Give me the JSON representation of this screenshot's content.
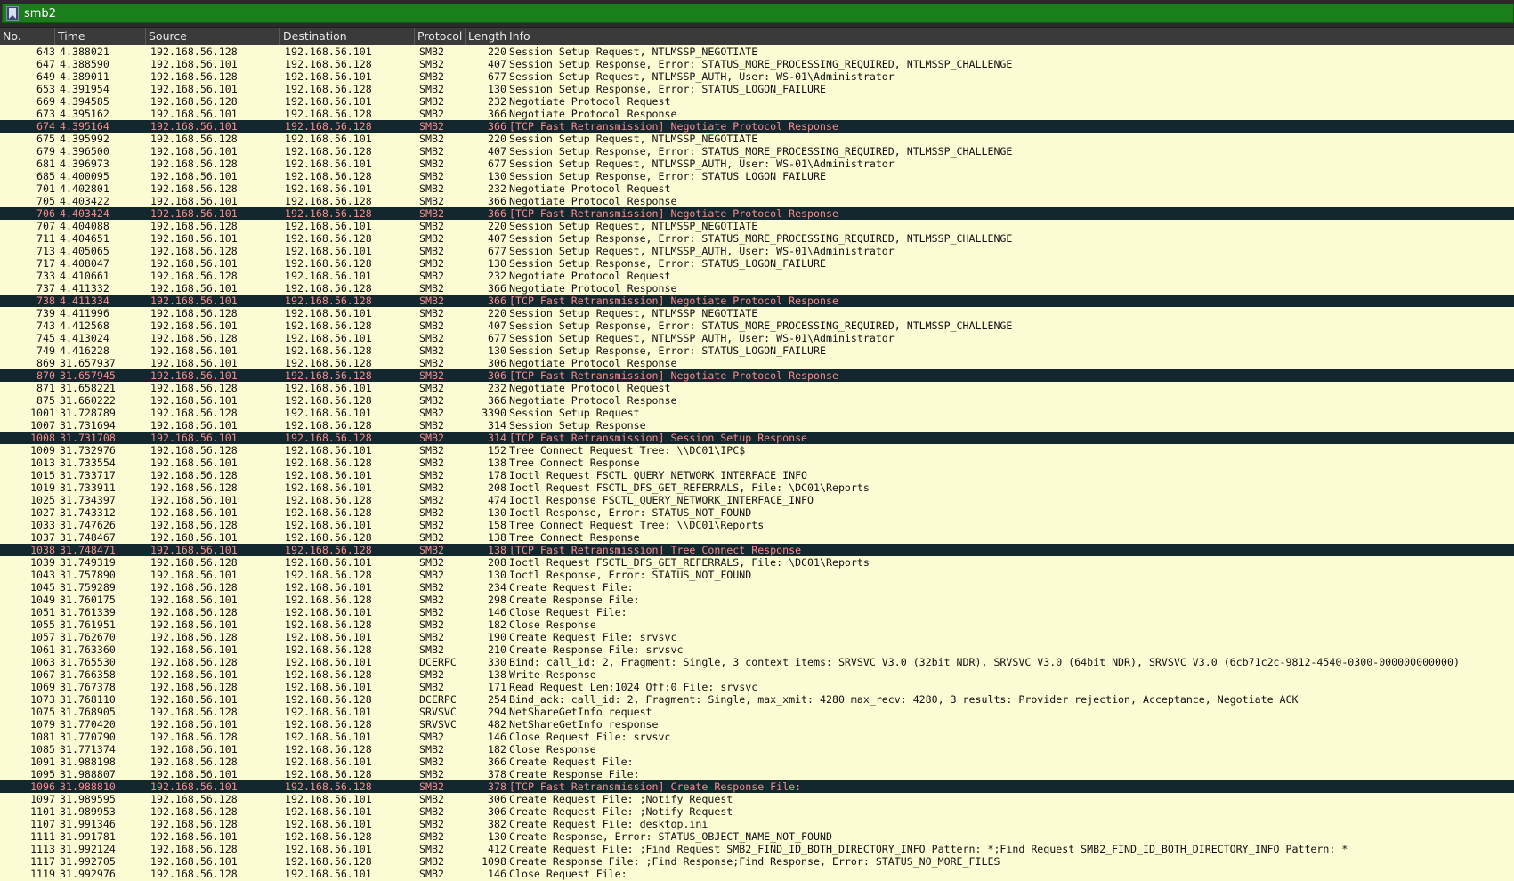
{
  "filter": {
    "value": "smb2"
  },
  "columns": [
    "No.",
    "Time",
    "Source",
    "Destination",
    "Protocol",
    "Length",
    "Info"
  ],
  "colors": {
    "row_bg": "#fbfbd4",
    "retrans_bg": "#12272e",
    "retrans_fg": "#f78c8c",
    "filter_bg": "#1a7f1a"
  },
  "rows": [
    {
      "no": "643",
      "time": "4.388021",
      "src": "192.168.56.128",
      "dst": "192.168.56.101",
      "proto": "SMB2",
      "len": "220",
      "info": "Session Setup Request, NTLMSSP_NEGOTIATE"
    },
    {
      "no": "647",
      "time": "4.388590",
      "src": "192.168.56.101",
      "dst": "192.168.56.128",
      "proto": "SMB2",
      "len": "407",
      "info": "Session Setup Response, Error: STATUS_MORE_PROCESSING_REQUIRED, NTLMSSP_CHALLENGE"
    },
    {
      "no": "649",
      "time": "4.389011",
      "src": "192.168.56.128",
      "dst": "192.168.56.101",
      "proto": "SMB2",
      "len": "677",
      "info": "Session Setup Request, NTLMSSP_AUTH, User: WS-01\\Administrator"
    },
    {
      "no": "653",
      "time": "4.391954",
      "src": "192.168.56.101",
      "dst": "192.168.56.128",
      "proto": "SMB2",
      "len": "130",
      "info": "Session Setup Response, Error: STATUS_LOGON_FAILURE"
    },
    {
      "no": "669",
      "time": "4.394585",
      "src": "192.168.56.128",
      "dst": "192.168.56.101",
      "proto": "SMB2",
      "len": "232",
      "info": "Negotiate Protocol Request"
    },
    {
      "no": "673",
      "time": "4.395162",
      "src": "192.168.56.101",
      "dst": "192.168.56.128",
      "proto": "SMB2",
      "len": "366",
      "info": "Negotiate Protocol Response"
    },
    {
      "no": "674",
      "time": "4.395164",
      "src": "192.168.56.101",
      "dst": "192.168.56.128",
      "proto": "SMB2",
      "len": "366",
      "info": "[TCP Fast Retransmission] Negotiate Protocol Response",
      "retrans": true
    },
    {
      "no": "675",
      "time": "4.395992",
      "src": "192.168.56.128",
      "dst": "192.168.56.101",
      "proto": "SMB2",
      "len": "220",
      "info": "Session Setup Request, NTLMSSP_NEGOTIATE"
    },
    {
      "no": "679",
      "time": "4.396500",
      "src": "192.168.56.101",
      "dst": "192.168.56.128",
      "proto": "SMB2",
      "len": "407",
      "info": "Session Setup Response, Error: STATUS_MORE_PROCESSING_REQUIRED, NTLMSSP_CHALLENGE"
    },
    {
      "no": "681",
      "time": "4.396973",
      "src": "192.168.56.128",
      "dst": "192.168.56.101",
      "proto": "SMB2",
      "len": "677",
      "info": "Session Setup Request, NTLMSSP_AUTH, User: WS-01\\Administrator"
    },
    {
      "no": "685",
      "time": "4.400095",
      "src": "192.168.56.101",
      "dst": "192.168.56.128",
      "proto": "SMB2",
      "len": "130",
      "info": "Session Setup Response, Error: STATUS_LOGON_FAILURE"
    },
    {
      "no": "701",
      "time": "4.402801",
      "src": "192.168.56.128",
      "dst": "192.168.56.101",
      "proto": "SMB2",
      "len": "232",
      "info": "Negotiate Protocol Request"
    },
    {
      "no": "705",
      "time": "4.403422",
      "src": "192.168.56.101",
      "dst": "192.168.56.128",
      "proto": "SMB2",
      "len": "366",
      "info": "Negotiate Protocol Response"
    },
    {
      "no": "706",
      "time": "4.403424",
      "src": "192.168.56.101",
      "dst": "192.168.56.128",
      "proto": "SMB2",
      "len": "366",
      "info": "[TCP Fast Retransmission] Negotiate Protocol Response",
      "retrans": true
    },
    {
      "no": "707",
      "time": "4.404088",
      "src": "192.168.56.128",
      "dst": "192.168.56.101",
      "proto": "SMB2",
      "len": "220",
      "info": "Session Setup Request, NTLMSSP_NEGOTIATE"
    },
    {
      "no": "711",
      "time": "4.404651",
      "src": "192.168.56.101",
      "dst": "192.168.56.128",
      "proto": "SMB2",
      "len": "407",
      "info": "Session Setup Response, Error: STATUS_MORE_PROCESSING_REQUIRED, NTLMSSP_CHALLENGE"
    },
    {
      "no": "713",
      "time": "4.405065",
      "src": "192.168.56.128",
      "dst": "192.168.56.101",
      "proto": "SMB2",
      "len": "677",
      "info": "Session Setup Request, NTLMSSP_AUTH, User: WS-01\\Administrator"
    },
    {
      "no": "717",
      "time": "4.408047",
      "src": "192.168.56.101",
      "dst": "192.168.56.128",
      "proto": "SMB2",
      "len": "130",
      "info": "Session Setup Response, Error: STATUS_LOGON_FAILURE"
    },
    {
      "no": "733",
      "time": "4.410661",
      "src": "192.168.56.128",
      "dst": "192.168.56.101",
      "proto": "SMB2",
      "len": "232",
      "info": "Negotiate Protocol Request"
    },
    {
      "no": "737",
      "time": "4.411332",
      "src": "192.168.56.101",
      "dst": "192.168.56.128",
      "proto": "SMB2",
      "len": "366",
      "info": "Negotiate Protocol Response"
    },
    {
      "no": "738",
      "time": "4.411334",
      "src": "192.168.56.101",
      "dst": "192.168.56.128",
      "proto": "SMB2",
      "len": "366",
      "info": "[TCP Fast Retransmission] Negotiate Protocol Response",
      "retrans": true
    },
    {
      "no": "739",
      "time": "4.411996",
      "src": "192.168.56.128",
      "dst": "192.168.56.101",
      "proto": "SMB2",
      "len": "220",
      "info": "Session Setup Request, NTLMSSP_NEGOTIATE"
    },
    {
      "no": "743",
      "time": "4.412568",
      "src": "192.168.56.101",
      "dst": "192.168.56.128",
      "proto": "SMB2",
      "len": "407",
      "info": "Session Setup Response, Error: STATUS_MORE_PROCESSING_REQUIRED, NTLMSSP_CHALLENGE"
    },
    {
      "no": "745",
      "time": "4.413024",
      "src": "192.168.56.128",
      "dst": "192.168.56.101",
      "proto": "SMB2",
      "len": "677",
      "info": "Session Setup Request, NTLMSSP_AUTH, User: WS-01\\Administrator"
    },
    {
      "no": "749",
      "time": "4.416228",
      "src": "192.168.56.101",
      "dst": "192.168.56.128",
      "proto": "SMB2",
      "len": "130",
      "info": "Session Setup Response, Error: STATUS_LOGON_FAILURE"
    },
    {
      "no": "869",
      "time": "31.657937",
      "src": "192.168.56.101",
      "dst": "192.168.56.128",
      "proto": "SMB2",
      "len": "306",
      "info": "Negotiate Protocol Response"
    },
    {
      "no": "870",
      "time": "31.657945",
      "src": "192.168.56.101",
      "dst": "192.168.56.128",
      "proto": "SMB2",
      "len": "306",
      "info": "[TCP Fast Retransmission] Negotiate Protocol Response",
      "retrans": true
    },
    {
      "no": "871",
      "time": "31.658221",
      "src": "192.168.56.128",
      "dst": "192.168.56.101",
      "proto": "SMB2",
      "len": "232",
      "info": "Negotiate Protocol Request"
    },
    {
      "no": "875",
      "time": "31.660222",
      "src": "192.168.56.101",
      "dst": "192.168.56.128",
      "proto": "SMB2",
      "len": "366",
      "info": "Negotiate Protocol Response"
    },
    {
      "no": "1001",
      "time": "31.728789",
      "src": "192.168.56.128",
      "dst": "192.168.56.101",
      "proto": "SMB2",
      "len": "3390",
      "info": "Session Setup Request"
    },
    {
      "no": "1007",
      "time": "31.731694",
      "src": "192.168.56.101",
      "dst": "192.168.56.128",
      "proto": "SMB2",
      "len": "314",
      "info": "Session Setup Response"
    },
    {
      "no": "1008",
      "time": "31.731708",
      "src": "192.168.56.101",
      "dst": "192.168.56.128",
      "proto": "SMB2",
      "len": "314",
      "info": "[TCP Fast Retransmission] Session Setup Response",
      "retrans": true
    },
    {
      "no": "1009",
      "time": "31.732976",
      "src": "192.168.56.128",
      "dst": "192.168.56.101",
      "proto": "SMB2",
      "len": "152",
      "info": "Tree Connect Request Tree: \\\\DC01\\IPC$"
    },
    {
      "no": "1013",
      "time": "31.733554",
      "src": "192.168.56.101",
      "dst": "192.168.56.128",
      "proto": "SMB2",
      "len": "138",
      "info": "Tree Connect Response"
    },
    {
      "no": "1015",
      "time": "31.733717",
      "src": "192.168.56.128",
      "dst": "192.168.56.101",
      "proto": "SMB2",
      "len": "178",
      "info": "Ioctl Request FSCTL_QUERY_NETWORK_INTERFACE_INFO"
    },
    {
      "no": "1019",
      "time": "31.733911",
      "src": "192.168.56.128",
      "dst": "192.168.56.101",
      "proto": "SMB2",
      "len": "208",
      "info": "Ioctl Request FSCTL_DFS_GET_REFERRALS, File: \\DC01\\Reports"
    },
    {
      "no": "1025",
      "time": "31.734397",
      "src": "192.168.56.101",
      "dst": "192.168.56.128",
      "proto": "SMB2",
      "len": "474",
      "info": "Ioctl Response FSCTL_QUERY_NETWORK_INTERFACE_INFO"
    },
    {
      "no": "1027",
      "time": "31.743312",
      "src": "192.168.56.101",
      "dst": "192.168.56.128",
      "proto": "SMB2",
      "len": "130",
      "info": "Ioctl Response, Error: STATUS_NOT_FOUND"
    },
    {
      "no": "1033",
      "time": "31.747626",
      "src": "192.168.56.128",
      "dst": "192.168.56.101",
      "proto": "SMB2",
      "len": "158",
      "info": "Tree Connect Request Tree: \\\\DC01\\Reports"
    },
    {
      "no": "1037",
      "time": "31.748467",
      "src": "192.168.56.101",
      "dst": "192.168.56.128",
      "proto": "SMB2",
      "len": "138",
      "info": "Tree Connect Response"
    },
    {
      "no": "1038",
      "time": "31.748471",
      "src": "192.168.56.101",
      "dst": "192.168.56.128",
      "proto": "SMB2",
      "len": "138",
      "info": "[TCP Fast Retransmission] Tree Connect Response",
      "retrans": true
    },
    {
      "no": "1039",
      "time": "31.749319",
      "src": "192.168.56.128",
      "dst": "192.168.56.101",
      "proto": "SMB2",
      "len": "208",
      "info": "Ioctl Request FSCTL_DFS_GET_REFERRALS, File: \\DC01\\Reports"
    },
    {
      "no": "1043",
      "time": "31.757890",
      "src": "192.168.56.101",
      "dst": "192.168.56.128",
      "proto": "SMB2",
      "len": "130",
      "info": "Ioctl Response, Error: STATUS_NOT_FOUND"
    },
    {
      "no": "1045",
      "time": "31.759289",
      "src": "192.168.56.128",
      "dst": "192.168.56.101",
      "proto": "SMB2",
      "len": "234",
      "info": "Create Request File:"
    },
    {
      "no": "1049",
      "time": "31.760175",
      "src": "192.168.56.101",
      "dst": "192.168.56.128",
      "proto": "SMB2",
      "len": "298",
      "info": "Create Response File:"
    },
    {
      "no": "1051",
      "time": "31.761339",
      "src": "192.168.56.128",
      "dst": "192.168.56.101",
      "proto": "SMB2",
      "len": "146",
      "info": "Close Request File:"
    },
    {
      "no": "1055",
      "time": "31.761951",
      "src": "192.168.56.101",
      "dst": "192.168.56.128",
      "proto": "SMB2",
      "len": "182",
      "info": "Close Response"
    },
    {
      "no": "1057",
      "time": "31.762670",
      "src": "192.168.56.128",
      "dst": "192.168.56.101",
      "proto": "SMB2",
      "len": "190",
      "info": "Create Request File: srvsvc"
    },
    {
      "no": "1061",
      "time": "31.763360",
      "src": "192.168.56.101",
      "dst": "192.168.56.128",
      "proto": "SMB2",
      "len": "210",
      "info": "Create Response File: srvsvc"
    },
    {
      "no": "1063",
      "time": "31.765530",
      "src": "192.168.56.128",
      "dst": "192.168.56.101",
      "proto": "DCERPC",
      "len": "330",
      "info": "Bind: call_id: 2, Fragment: Single, 3 context items: SRVSVC V3.0 (32bit NDR), SRVSVC V3.0 (64bit NDR), SRVSVC V3.0 (6cb71c2c-9812-4540-0300-000000000000)"
    },
    {
      "no": "1067",
      "time": "31.766358",
      "src": "192.168.56.101",
      "dst": "192.168.56.128",
      "proto": "SMB2",
      "len": "138",
      "info": "Write Response"
    },
    {
      "no": "1069",
      "time": "31.767378",
      "src": "192.168.56.128",
      "dst": "192.168.56.101",
      "proto": "SMB2",
      "len": "171",
      "info": "Read Request Len:1024 Off:0 File: srvsvc"
    },
    {
      "no": "1073",
      "time": "31.768110",
      "src": "192.168.56.101",
      "dst": "192.168.56.128",
      "proto": "DCERPC",
      "len": "254",
      "info": "Bind_ack: call_id: 2, Fragment: Single, max_xmit: 4280 max_recv: 4280, 3 results: Provider rejection, Acceptance, Negotiate ACK"
    },
    {
      "no": "1075",
      "time": "31.768905",
      "src": "192.168.56.128",
      "dst": "192.168.56.101",
      "proto": "SRVSVC",
      "len": "294",
      "info": "NetShareGetInfo request"
    },
    {
      "no": "1079",
      "time": "31.770420",
      "src": "192.168.56.101",
      "dst": "192.168.56.128",
      "proto": "SRVSVC",
      "len": "482",
      "info": "NetShareGetInfo response"
    },
    {
      "no": "1081",
      "time": "31.770790",
      "src": "192.168.56.128",
      "dst": "192.168.56.101",
      "proto": "SMB2",
      "len": "146",
      "info": "Close Request File: srvsvc"
    },
    {
      "no": "1085",
      "time": "31.771374",
      "src": "192.168.56.101",
      "dst": "192.168.56.128",
      "proto": "SMB2",
      "len": "182",
      "info": "Close Response"
    },
    {
      "no": "1091",
      "time": "31.988198",
      "src": "192.168.56.128",
      "dst": "192.168.56.101",
      "proto": "SMB2",
      "len": "366",
      "info": "Create Request File:"
    },
    {
      "no": "1095",
      "time": "31.988807",
      "src": "192.168.56.101",
      "dst": "192.168.56.128",
      "proto": "SMB2",
      "len": "378",
      "info": "Create Response File:"
    },
    {
      "no": "1096",
      "time": "31.988810",
      "src": "192.168.56.101",
      "dst": "192.168.56.128",
      "proto": "SMB2",
      "len": "378",
      "info": "[TCP Fast Retransmission] Create Response File:",
      "retrans": true
    },
    {
      "no": "1097",
      "time": "31.989595",
      "src": "192.168.56.128",
      "dst": "192.168.56.101",
      "proto": "SMB2",
      "len": "306",
      "info": "Create Request File: ;Notify Request"
    },
    {
      "no": "1101",
      "time": "31.989953",
      "src": "192.168.56.128",
      "dst": "192.168.56.101",
      "proto": "SMB2",
      "len": "306",
      "info": "Create Request File: ;Notify Request"
    },
    {
      "no": "1107",
      "time": "31.991346",
      "src": "192.168.56.128",
      "dst": "192.168.56.101",
      "proto": "SMB2",
      "len": "382",
      "info": "Create Request File: desktop.ini"
    },
    {
      "no": "1111",
      "time": "31.991781",
      "src": "192.168.56.101",
      "dst": "192.168.56.128",
      "proto": "SMB2",
      "len": "130",
      "info": "Create Response, Error: STATUS_OBJECT_NAME_NOT_FOUND"
    },
    {
      "no": "1113",
      "time": "31.992124",
      "src": "192.168.56.128",
      "dst": "192.168.56.101",
      "proto": "SMB2",
      "len": "412",
      "info": "Create Request File: ;Find Request SMB2_FIND_ID_BOTH_DIRECTORY_INFO Pattern: *;Find Request SMB2_FIND_ID_BOTH_DIRECTORY_INFO Pattern: *"
    },
    {
      "no": "1117",
      "time": "31.992705",
      "src": "192.168.56.101",
      "dst": "192.168.56.128",
      "proto": "SMB2",
      "len": "1098",
      "info": "Create Response File: ;Find Response;Find Response, Error: STATUS_NO_MORE_FILES"
    },
    {
      "no": "1119",
      "time": "31.992976",
      "src": "192.168.56.128",
      "dst": "192.168.56.101",
      "proto": "SMB2",
      "len": "146",
      "info": "Close Request File:"
    }
  ]
}
